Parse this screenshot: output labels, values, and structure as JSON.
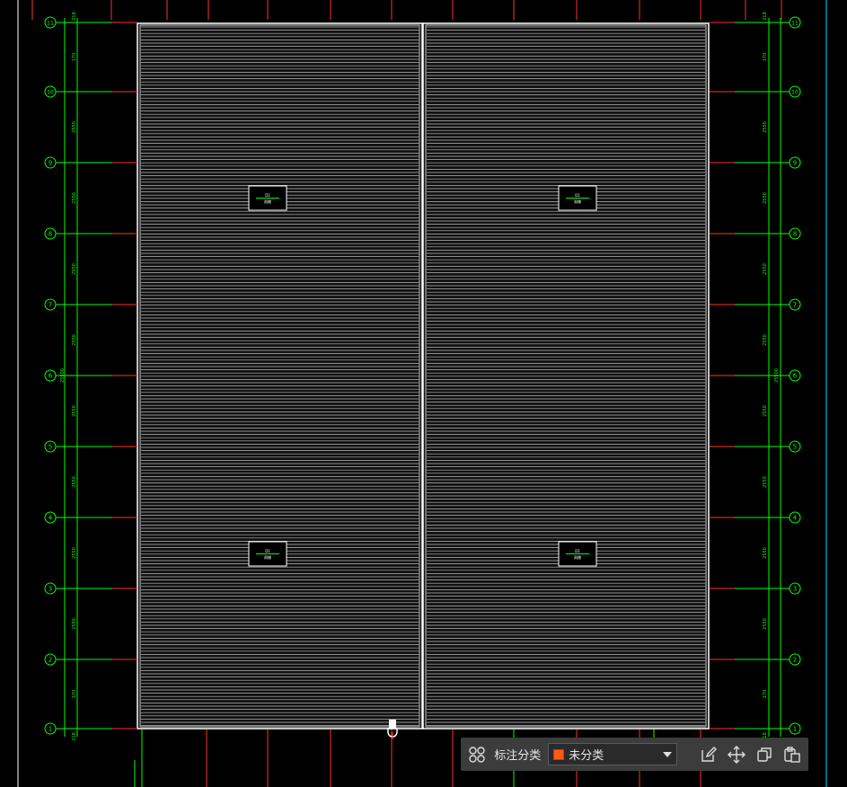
{
  "canvas": {
    "background": "#000000",
    "grid_color": "#00ff00",
    "axis_tick_color": "#ff3030",
    "panel_fill": "#111111",
    "stripe_color": "#d8d8d8",
    "border_color": "#ffffff",
    "grid_labels": [
      "1",
      "2",
      "3",
      "4",
      "5",
      "6",
      "7",
      "8",
      "9",
      "10",
      "11"
    ],
    "dim_labels_left": [
      "170",
      "2550",
      "2550",
      "2550",
      "2550",
      "2550",
      "2550",
      "2550",
      "2550",
      "170"
    ],
    "dim_labels_right": [
      "170",
      "2550",
      "2550",
      "2550",
      "2550",
      "2550",
      "2550",
      "2550",
      "2550",
      "170"
    ],
    "end_dim_label": "218",
    "overall_dim_label": "25500",
    "tags": [
      {
        "line1": "D1",
        "line2": "雨棚"
      },
      {
        "line1": "D1",
        "line2": "雨棚"
      },
      {
        "line1": "D1",
        "line2": "雨棚"
      },
      {
        "line1": "D1",
        "line2": "雨棚"
      }
    ]
  },
  "toolbar": {
    "category_label": "标注分类",
    "selected_category": "未分类",
    "selected_color": "#ff5a14",
    "icons": [
      "grid-apps-icon",
      "edit-icon",
      "move-icon",
      "copy-icon",
      "paste-icon"
    ]
  }
}
